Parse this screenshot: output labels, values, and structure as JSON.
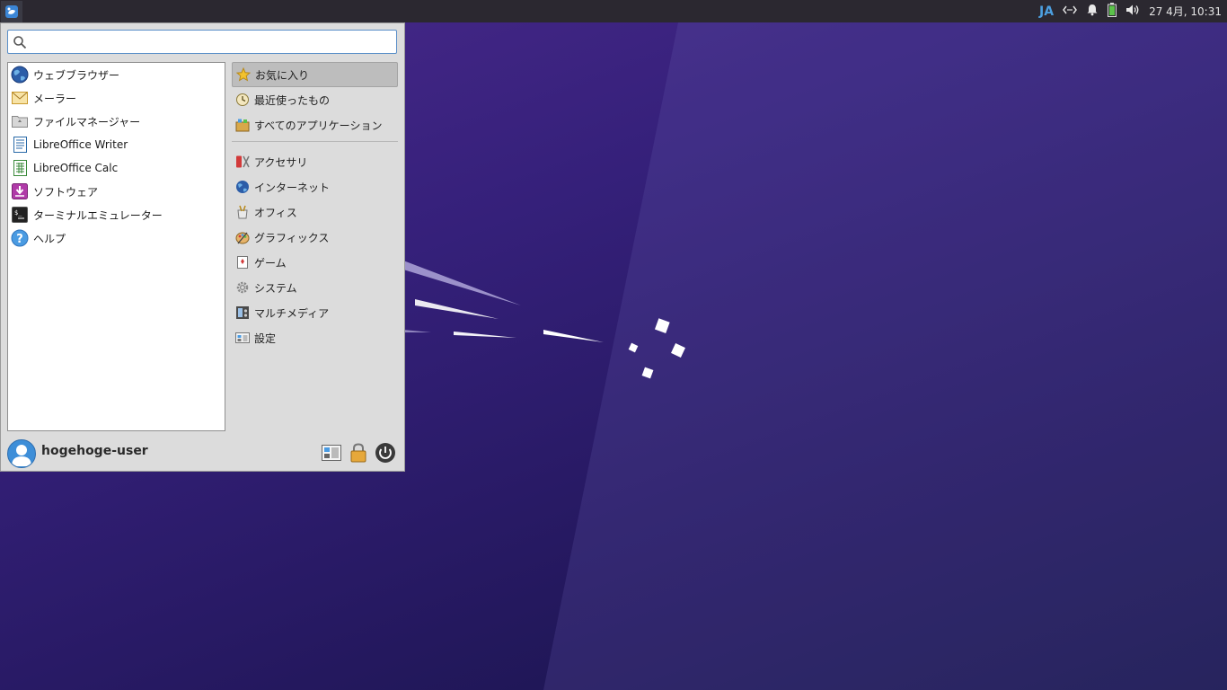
{
  "panel": {
    "input_method": "JA",
    "clock": "27 4月, 10:31"
  },
  "menu": {
    "search": {
      "value": "",
      "placeholder": ""
    },
    "favorites": [
      {
        "label": "ウェブブラウザー",
        "icon": "web-browser-icon"
      },
      {
        "label": "メーラー",
        "icon": "mail-icon"
      },
      {
        "label": "ファイルマネージャー",
        "icon": "file-manager-icon"
      },
      {
        "label": "LibreOffice Writer",
        "icon": "writer-icon"
      },
      {
        "label": "LibreOffice Calc",
        "icon": "calc-icon"
      },
      {
        "label": "ソフトウェア",
        "icon": "software-icon"
      },
      {
        "label": "ターミナルエミュレーター",
        "icon": "terminal-icon"
      },
      {
        "label": "ヘルプ",
        "icon": "help-icon"
      }
    ],
    "categories_top": [
      {
        "label": "お気に入り",
        "icon": "star-icon",
        "active": true
      },
      {
        "label": "最近使ったもの",
        "icon": "recent-icon"
      },
      {
        "label": "すべてのアプリケーション",
        "icon": "all-apps-icon"
      }
    ],
    "categories": [
      {
        "label": "アクセサリ",
        "icon": "accessories-icon"
      },
      {
        "label": "インターネット",
        "icon": "internet-icon"
      },
      {
        "label": "オフィス",
        "icon": "office-icon"
      },
      {
        "label": "グラフィックス",
        "icon": "graphics-icon"
      },
      {
        "label": "ゲーム",
        "icon": "games-icon"
      },
      {
        "label": "システム",
        "icon": "system-icon"
      },
      {
        "label": "マルチメディア",
        "icon": "multimedia-icon"
      },
      {
        "label": "設定",
        "icon": "settings-icon"
      }
    ],
    "user": {
      "name": "hogehoge-user"
    }
  },
  "colors": {
    "accent": "#3d8ed8",
    "panel_bg": "#2b2830",
    "menu_bg": "#dcdcdc",
    "desktop": "#2a1f6b"
  }
}
